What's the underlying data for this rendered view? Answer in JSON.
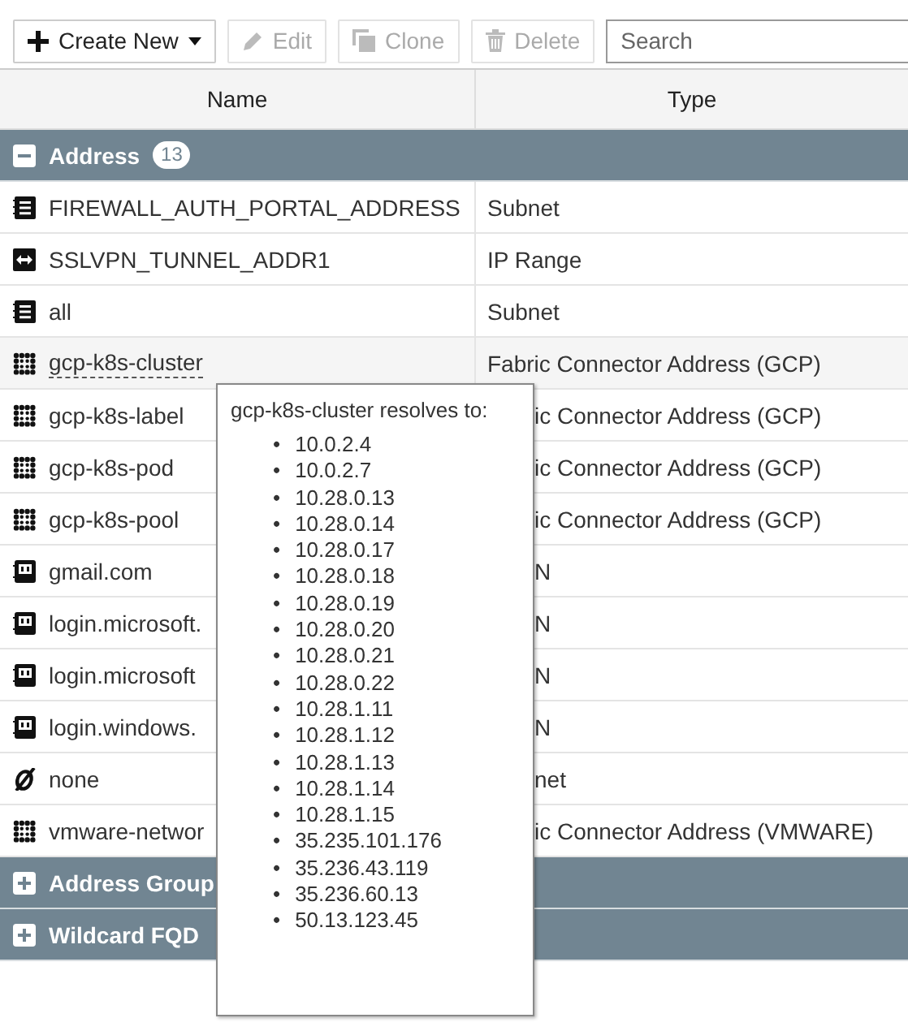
{
  "toolbar": {
    "buttons": [
      {
        "label": "Create New",
        "kind": "create",
        "disabled": false
      },
      {
        "label": "Edit",
        "kind": "edit",
        "disabled": true
      },
      {
        "label": "Clone",
        "kind": "clone",
        "disabled": true
      },
      {
        "label": "Delete",
        "kind": "delete",
        "disabled": true
      }
    ],
    "search": {
      "placeholder": "Search"
    }
  },
  "table": {
    "columns": [
      "Name",
      "Type"
    ],
    "groups": [
      {
        "label": "Address",
        "count": "13",
        "expanded": true,
        "rows": [
          {
            "name": "FIREWALL_AUTH_PORTAL_ADDRESS",
            "type": "Subnet",
            "kind": "subnet",
            "hovered": false,
            "covered": false
          },
          {
            "name": "SSLVPN_TUNNEL_ADDR1",
            "type": "IP Range",
            "kind": "iprange",
            "hovered": false,
            "covered": false
          },
          {
            "name": "all",
            "type": "Subnet",
            "kind": "subnet",
            "hovered": false,
            "covered": false
          },
          {
            "name": "gcp-k8s-cluster",
            "type": "Fabric Connector Address (GCP)",
            "kind": "fabric",
            "hovered": true,
            "covered": false
          },
          {
            "name": "gcp-k8s-label",
            "type": "ic Connector Address (GCP)",
            "kind": "fabric",
            "hovered": false,
            "covered": true
          },
          {
            "name": "gcp-k8s-pod",
            "type": "ic Connector Address (GCP)",
            "kind": "fabric",
            "hovered": false,
            "covered": true
          },
          {
            "name": "gcp-k8s-pool",
            "type": "ic Connector Address (GCP)",
            "kind": "fabric",
            "hovered": false,
            "covered": true
          },
          {
            "name": "gmail.com",
            "type": "N",
            "kind": "fqdn",
            "hovered": false,
            "covered": true
          },
          {
            "name": "login.microsoft.",
            "type": "N",
            "kind": "fqdn",
            "hovered": false,
            "covered": true
          },
          {
            "name": "login.microsoft",
            "type": "N",
            "kind": "fqdn",
            "hovered": false,
            "covered": true
          },
          {
            "name": "login.windows.",
            "type": "N",
            "kind": "fqdn",
            "hovered": false,
            "covered": true
          },
          {
            "name": "none",
            "type": "net",
            "kind": "none",
            "hovered": false,
            "covered": true
          },
          {
            "name": "vmware-networ",
            "type": "ic Connector Address (VMWARE)",
            "kind": "fabric",
            "hovered": false,
            "covered": true
          }
        ]
      },
      {
        "label": "Address Group",
        "expanded": false
      },
      {
        "label": "Wildcard FQD",
        "expanded": false
      }
    ]
  },
  "tooltip": {
    "title": "gcp-k8s-cluster resolves to:",
    "bullet": "•",
    "items": [
      "10.0.2.4",
      "10.0.2.7",
      "10.28.0.13",
      "10.28.0.14",
      "10.28.0.17",
      "10.28.0.18",
      "10.28.0.19",
      "10.28.0.20",
      "10.28.0.21",
      "10.28.0.22",
      "10.28.1.11",
      "10.28.1.12",
      "10.28.1.13",
      "10.28.1.14",
      "10.28.1.15",
      "35.235.101.176",
      "35.236.43.119",
      "35.236.60.13",
      "50.13.123.45"
    ]
  }
}
